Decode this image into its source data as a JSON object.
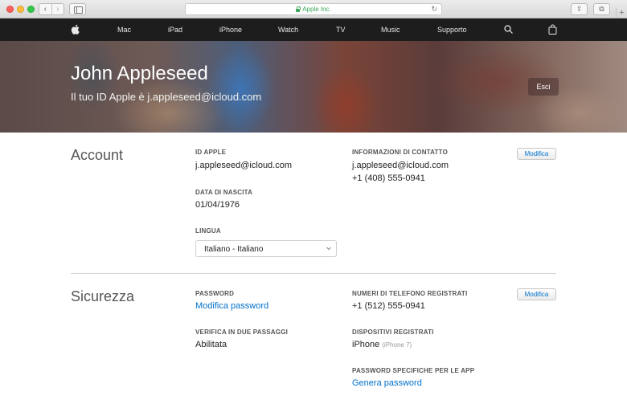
{
  "browser": {
    "url_text": "Apple Inc.",
    "back_icon": "‹",
    "forward_icon": "›",
    "reload_icon": "↻",
    "share_icon": "⇪",
    "tabs_icon": "⧉",
    "new_tab_icon": "+"
  },
  "nav": {
    "items": [
      "Mac",
      "iPad",
      "iPhone",
      "Watch",
      "TV",
      "Music",
      "Supporto"
    ]
  },
  "hero": {
    "name": "John Appleseed",
    "subtitle": "Il tuo ID Apple è j.appleseed@icloud.com",
    "signout_label": "Esci"
  },
  "account": {
    "title": "Account",
    "edit_label": "Modifica",
    "apple_id_label": "ID APPLE",
    "apple_id_value": "j.appleseed@icloud.com",
    "birth_label": "DATA DI NASCITA",
    "birth_value": "01/04/1976",
    "language_label": "LINGUA",
    "language_value": "Italiano - Italiano",
    "contact_label": "INFORMAZIONI DI CONTATTO",
    "contact_email": "j.appleseed@icloud.com",
    "contact_phone": "+1 (408) 555-0941"
  },
  "security": {
    "title": "Sicurezza",
    "edit_label": "Modifica",
    "password_label": "PASSWORD",
    "password_link": "Modifica password",
    "twostep_label": "VERIFICA IN DUE PASSAGGI",
    "twostep_value": "Abilitata",
    "phones_label": "NUMERI DI TELEFONO REGISTRATI",
    "phones_value": "+1 (512) 555-0941",
    "devices_label": "DISPOSITIVI REGISTRATI",
    "device_name": "iPhone",
    "device_model": "(iPhone 7)",
    "app_pw_label": "PASSWORD SPECIFICHE PER LE APP",
    "app_pw_link": "Genera password"
  },
  "colors": {
    "link": "#0070c9",
    "nav_bg": "#1d1d1d",
    "secure_green": "#3aa757"
  }
}
